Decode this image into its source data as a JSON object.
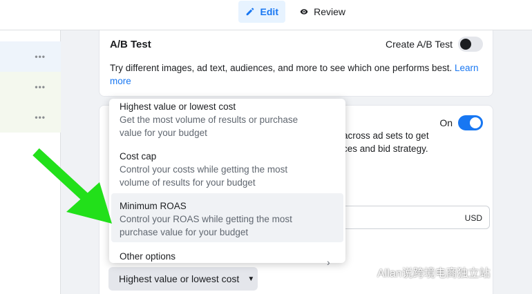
{
  "tabs": {
    "edit": "Edit",
    "review": "Review"
  },
  "left_rows": [
    {
      "menu": "•••"
    },
    {
      "menu": "•••"
    },
    {
      "menu": "•••"
    }
  ],
  "ab_test": {
    "title": "A/B Test",
    "create_label": "Create A/B Test",
    "toggle_on": false,
    "description": "Try different images, ad text, audiences, and more to see which one performs best.",
    "learn_more": "Learn more"
  },
  "budget": {
    "on_label": "On",
    "toggle_on": true,
    "desc_line1": "across ad sets to get",
    "desc_line2": "ces and bid strategy.",
    "currency": "USD"
  },
  "bid_menu": {
    "options": [
      {
        "title": "Highest value or lowest cost",
        "desc": "Get the most volume of results or purchase value for your budget"
      },
      {
        "title": "Cost cap",
        "desc": "Control your costs while getting the most volume of results for your budget"
      },
      {
        "title": "Minimum ROAS",
        "desc": "Control your ROAS while getting the most purchase value for your budget"
      },
      {
        "title": "Other options",
        "desc": ""
      }
    ],
    "selected": "Highest value or lowest cost"
  },
  "watermark": "Allan说跨境电商独立站",
  "colors": {
    "accent": "#1877f2",
    "arrow": "#22e01a"
  }
}
